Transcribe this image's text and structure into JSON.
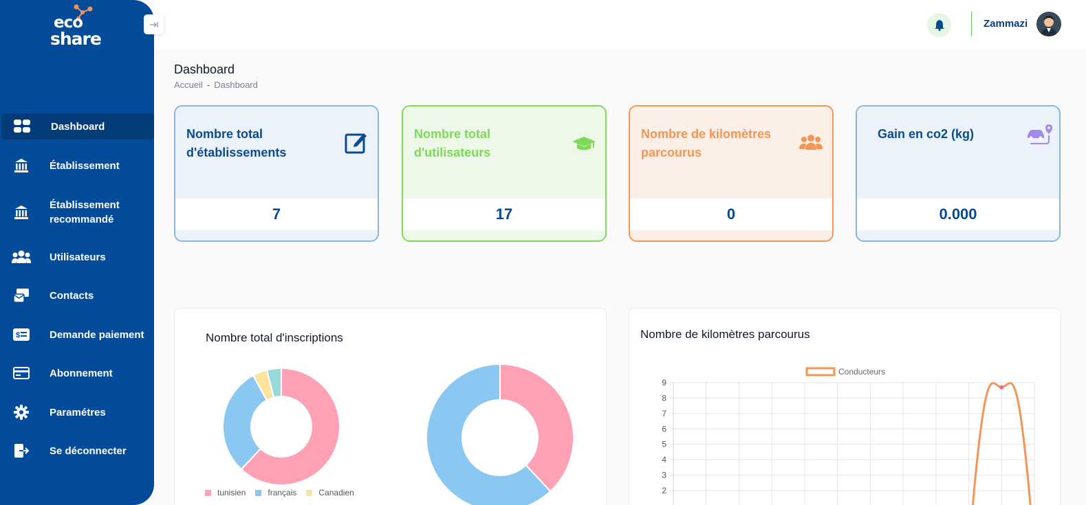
{
  "app": {
    "logo_top": "eco",
    "logo_bottom": "share"
  },
  "sidebar": {
    "collapse_icon": "arrow-right-icon",
    "items": [
      {
        "label": "Dashboard",
        "icon": "dashboard-icon"
      },
      {
        "label": "Établissement",
        "icon": "institution-icon"
      },
      {
        "label": "Établissement recommandé",
        "icon": "institution-icon"
      },
      {
        "label": "Utilisateurs",
        "icon": "users-icon"
      },
      {
        "label": "Contacts",
        "icon": "contacts-icon"
      },
      {
        "label": "Demande paiement",
        "icon": "money-bill-icon"
      },
      {
        "label": "Abonnement",
        "icon": "credit-card-icon"
      },
      {
        "label": "Paramétres",
        "icon": "gear-icon"
      },
      {
        "label": "Se déconnecter",
        "icon": "logout-icon"
      }
    ]
  },
  "header": {
    "username": "Zammazi"
  },
  "page": {
    "title": "Dashboard",
    "breadcrumb": [
      "Accueil",
      "-",
      "Dashboard"
    ]
  },
  "stats": [
    {
      "title": "Nombre total d'établissements",
      "value": "7",
      "icon": "edit-icon",
      "color": "#0b4b8f"
    },
    {
      "title": "Nombre total d'utilisateurs",
      "value": "17",
      "icon": "graduation-cap-icon",
      "color": "#7ed957"
    },
    {
      "title": "Nombre de kilomètres parcourus",
      "value": "0",
      "icon": "users-icon",
      "color": "#f39653"
    },
    {
      "title": "Gain en co2 (kg)",
      "value": "0.000",
      "icon": "car-route-icon",
      "color": "#0b4b8f"
    }
  ],
  "panels": {
    "inscriptions": {
      "title": "Nombre total d'inscriptions",
      "legend": [
        {
          "label": "tunisien",
          "color": "#ffa1b5"
        },
        {
          "label": "français",
          "color": "#8ac7f1"
        },
        {
          "label": "Canadien",
          "color": "#fde49c"
        }
      ]
    },
    "kilometres": {
      "title": "Nombre de kilomètres parcourus"
    }
  },
  "chart_data": [
    {
      "type": "pie",
      "variant": "doughnut",
      "slices": [
        {
          "label": "tunisien",
          "value": 62,
          "color": "#ffa1b5"
        },
        {
          "label": "français",
          "value": 30,
          "color": "#8ac7f1"
        },
        {
          "label": "Canadien",
          "value": 4,
          "color": "#fde49c"
        },
        {
          "label": "",
          "value": 4,
          "color": "#9ad9d9"
        }
      ]
    },
    {
      "type": "pie",
      "variant": "doughnut",
      "slices": [
        {
          "label": "",
          "value": 38,
          "color": "#ffa1b5"
        },
        {
          "label": "",
          "value": 62,
          "color": "#8ac7f1"
        }
      ]
    },
    {
      "type": "line",
      "series": [
        {
          "name": "Conducteurs",
          "color": "#f39653",
          "peak_x": 10,
          "peak_y": 8.7
        }
      ],
      "x_count": 11,
      "ylim": [
        0,
        9
      ],
      "yticks": [
        2,
        3,
        4,
        5,
        6,
        7,
        8,
        9
      ],
      "grid": true,
      "legend": "top"
    }
  ]
}
